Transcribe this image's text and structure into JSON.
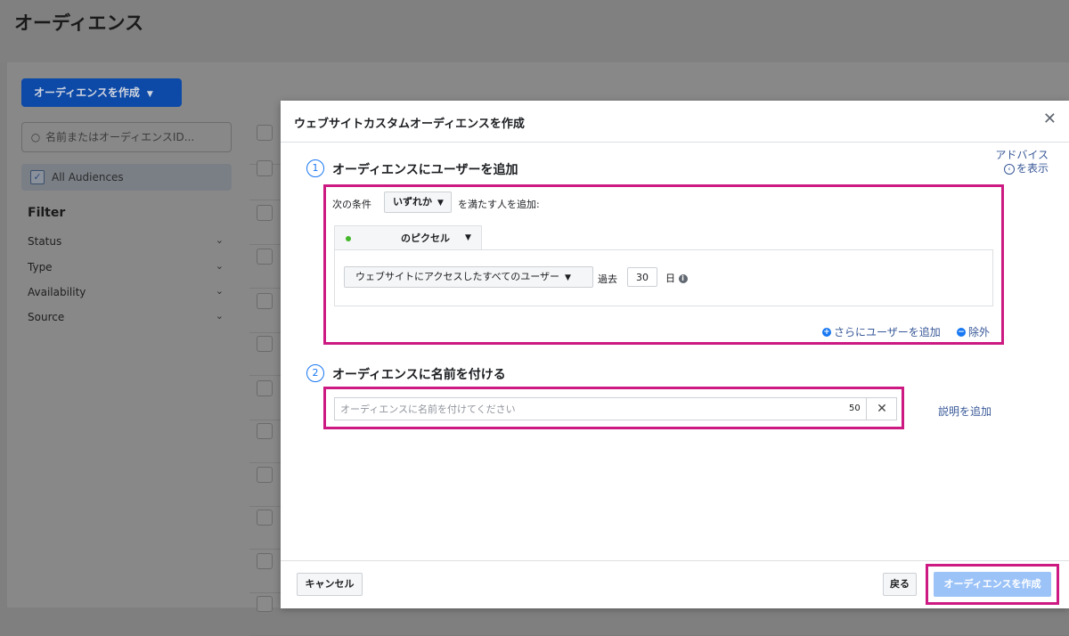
{
  "page": {
    "title": "オーディエンス",
    "create_button": "オーディエンスを作成",
    "search_placeholder": "名前またはオーディエンスID...",
    "all_audiences": "All Audiences",
    "filter_title": "Filter",
    "filters": [
      "Status",
      "Type",
      "Availability",
      "Source"
    ]
  },
  "modal": {
    "title": "ウェブサイトカスタムオーディエンスを作成",
    "advice_line1": "アドバイス",
    "advice_line2": "を表示",
    "step1": {
      "number": "1",
      "title": "オーディエンスにユーザーを追加",
      "condition_prefix": "次の条件",
      "condition_select": "いずれか",
      "condition_suffix": "を満たす人を追加:",
      "pixel_label": "のピクセル",
      "rule_select": "ウェブサイトにアクセスしたすべてのユーザー",
      "past_label": "過去",
      "days_value": "30",
      "days_unit": "日",
      "add_more": "さらにユーザーを追加",
      "exclude": "除外"
    },
    "step2": {
      "number": "2",
      "title": "オーディエンスに名前を付ける",
      "name_placeholder": "オーディエンスに名前を付けてください",
      "char_count": "50",
      "add_description": "説明を追加"
    },
    "footer": {
      "cancel": "キャンセル",
      "back": "戻る",
      "create": "オーディエンスを作成"
    }
  },
  "colors": {
    "highlight": "#cc1a82",
    "primary": "#1877f2",
    "link": "#385898",
    "pixel_dot": "#42b72a"
  }
}
